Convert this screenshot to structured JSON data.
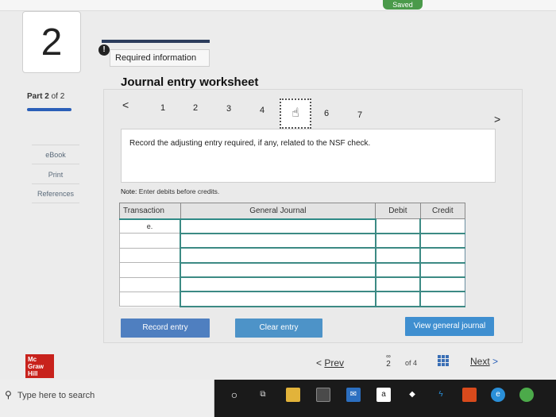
{
  "status": {
    "saved": "Saved"
  },
  "question": {
    "number": "2"
  },
  "sidebar": {
    "part_word": "Part",
    "part_num": "2",
    "part_of": "of 2",
    "links": [
      "eBook",
      "Print",
      "References"
    ]
  },
  "header": {
    "alert_glyph": "!",
    "required_info": "Required information",
    "title": "Journal entry worksheet"
  },
  "tabs": {
    "prev_glyph": "<",
    "next_glyph": ">",
    "items": [
      "1",
      "2",
      "3",
      "4",
      "5",
      "6",
      "7"
    ],
    "active_index": 4
  },
  "instruction": "Record the adjusting entry required, if any, related to the NSF check.",
  "note": {
    "label": "Note:",
    "text": "Enter debits before credits."
  },
  "table": {
    "headers": {
      "transaction": "Transaction",
      "general_journal": "General Journal",
      "debit": "Debit",
      "credit": "Credit"
    },
    "rows": [
      {
        "transaction": "e.",
        "account": "",
        "debit": "",
        "credit": ""
      },
      {
        "transaction": "",
        "account": "",
        "debit": "",
        "credit": ""
      },
      {
        "transaction": "",
        "account": "",
        "debit": "",
        "credit": ""
      },
      {
        "transaction": "",
        "account": "",
        "debit": "",
        "credit": ""
      },
      {
        "transaction": "",
        "account": "",
        "debit": "",
        "credit": ""
      },
      {
        "transaction": "",
        "account": "",
        "debit": "",
        "credit": ""
      }
    ]
  },
  "buttons": {
    "record": "Record entry",
    "clear": "Clear entry",
    "view": "View general journal"
  },
  "logo": {
    "line1": "Mc",
    "line2": "Graw",
    "line3": "Hill"
  },
  "pagination": {
    "prev_glyph": "<",
    "prev_label": "Prev",
    "current": "2",
    "of": "of 4",
    "next_label": "Next",
    "next_glyph": ">"
  },
  "taskbar": {
    "search_placeholder": "Type here to search",
    "icons": [
      "cortana-icon",
      "task-view-icon",
      "file-explorer-icon",
      "store-icon",
      "mail-icon",
      "amazon-icon",
      "dropbox-icon",
      "app-icon",
      "office-icon",
      "edge-icon",
      "chrome-icon"
    ]
  },
  "colors": {
    "primary_blue": "#2a5fb8",
    "button_blue": "#4f7fc0",
    "table_border_teal": "#2f8a86",
    "logo_red": "#c8221c",
    "saved_green": "#4a9a4a"
  }
}
